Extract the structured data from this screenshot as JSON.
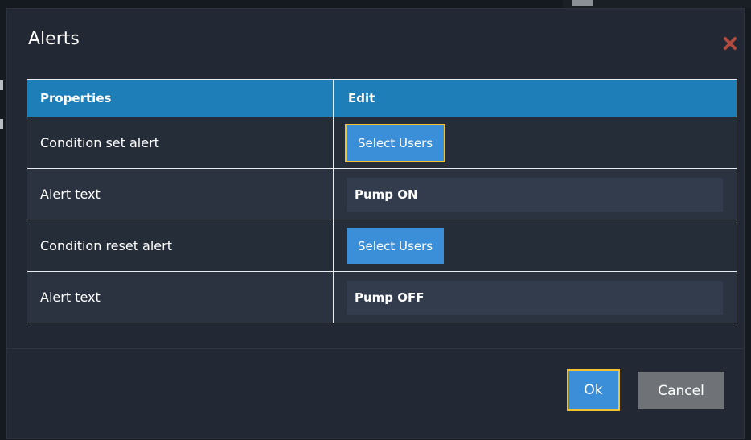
{
  "dialog": {
    "title": "Alerts",
    "close_icon": "close-icon"
  },
  "table": {
    "headers": [
      "Properties",
      "Edit"
    ],
    "rows": [
      {
        "property": "Condition set alert",
        "edit_type": "button",
        "value": "Select Users"
      },
      {
        "property": "Alert text",
        "edit_type": "text",
        "value": "Pump ON"
      },
      {
        "property": "Condition reset alert",
        "edit_type": "button",
        "value": "Select Users"
      },
      {
        "property": "Alert text",
        "edit_type": "text",
        "value": "Pump OFF"
      }
    ]
  },
  "footer": {
    "ok_label": "Ok",
    "cancel_label": "Cancel"
  },
  "colors": {
    "accent": "#3a8fd8",
    "header": "#1e7fb8",
    "focus": "#f2c230",
    "close": "#b14a3f"
  }
}
